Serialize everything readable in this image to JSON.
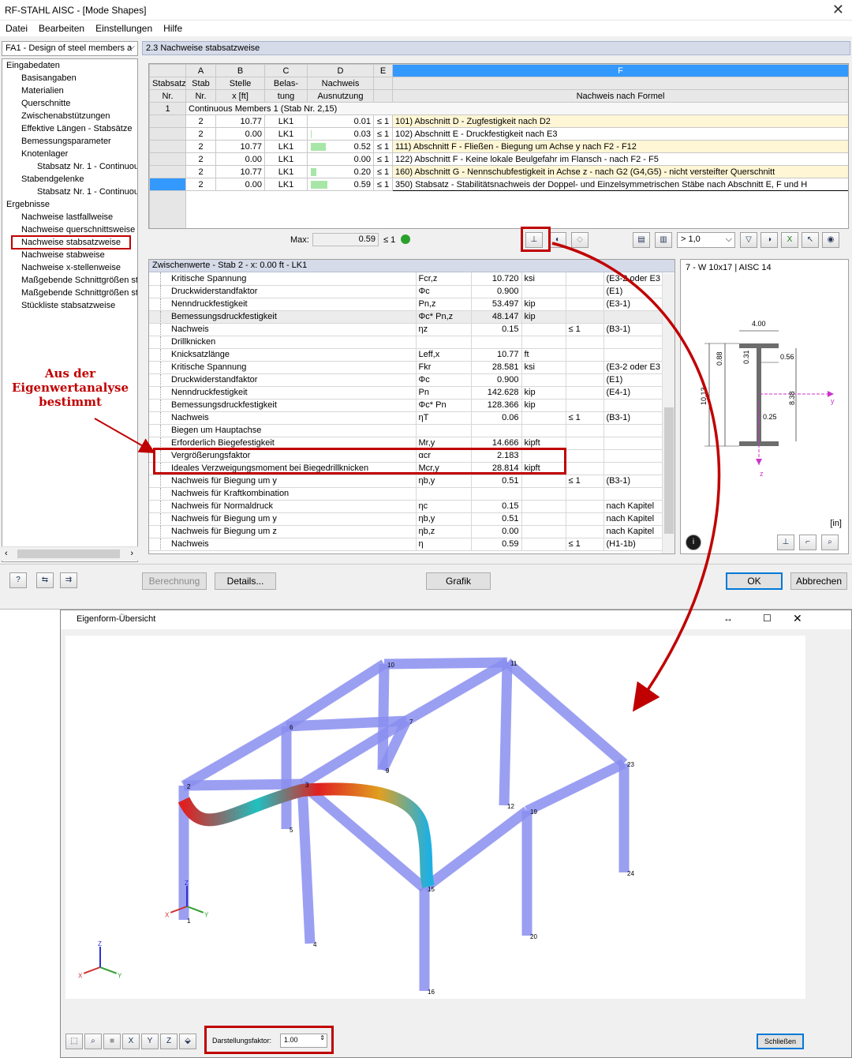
{
  "window": {
    "title": "RF-STAHL AISC - [Mode Shapes]",
    "close": "✕"
  },
  "menu": [
    "Datei",
    "Bearbeiten",
    "Einstellungen",
    "Hilfe"
  ],
  "case_combo": "FA1 - Design of steel members a",
  "tree": [
    {
      "label": "Eingabedaten",
      "level": 0
    },
    {
      "label": "Basisangaben",
      "level": 1
    },
    {
      "label": "Materialien",
      "level": 1
    },
    {
      "label": "Querschnitte",
      "level": 1
    },
    {
      "label": "Zwischenabstützungen",
      "level": 1
    },
    {
      "label": "Effektive Längen - Stabsätze",
      "level": 1
    },
    {
      "label": "Bemessungsparameter",
      "level": 1
    },
    {
      "label": "Knotenlager",
      "level": 1
    },
    {
      "label": "Stabsatz Nr. 1 - Continuous",
      "level": 2
    },
    {
      "label": "Stabendgelenke",
      "level": 1
    },
    {
      "label": "Stabsatz Nr. 1 - Continuous",
      "level": 2
    },
    {
      "label": "Ergebnisse",
      "level": 0
    },
    {
      "label": "Nachweise lastfallweise",
      "level": 1
    },
    {
      "label": "Nachweise querschnittsweise",
      "level": 1
    },
    {
      "label": "Nachweise stabsatzweise",
      "level": 1,
      "selected": true
    },
    {
      "label": "Nachweise stabweise",
      "level": 1
    },
    {
      "label": "Nachweise x-stellenweise",
      "level": 1
    },
    {
      "label": "Maßgebende Schnittgrößen sta",
      "level": 1
    },
    {
      "label": "Maßgebende Schnittgrößen sta",
      "level": 1
    },
    {
      "label": "Stückliste stabsatzweise",
      "level": 1
    }
  ],
  "section_title": "2.3 Nachweise stabsatzweise",
  "grid": {
    "col_letters": [
      "A",
      "B",
      "C",
      "D",
      "E",
      "F"
    ],
    "head1": {
      "stabsatz": "Stabsatz",
      "stab": "Stab",
      "stelle": "Stelle",
      "belas": "Belas-",
      "nachweis": "Nachweis"
    },
    "head2": {
      "nr": "Nr.",
      "stabnr": "Nr.",
      "x": "x [ft]",
      "tung": "tung",
      "ausnutzung": "Ausnutzung",
      "formel": "Nachweis nach Formel"
    },
    "group": {
      "nr": "1",
      "label": "Continuous Members 1 (Stab Nr. 2,15)"
    },
    "rows": [
      {
        "stab": "2",
        "x": "10.77",
        "lc": "LK1",
        "val": "0.01",
        "le": "≤ 1",
        "formula": "101) Abschnitt D - Zugfestigkeit nach D2",
        "bar": 0.01
      },
      {
        "stab": "2",
        "x": "0.00",
        "lc": "LK1",
        "val": "0.03",
        "le": "≤ 1",
        "formula": "102) Abschnitt E - Druckfestigkeit nach E3",
        "bar": 0.03
      },
      {
        "stab": "2",
        "x": "10.77",
        "lc": "LK1",
        "val": "0.52",
        "le": "≤ 1",
        "formula": "111) Abschnitt F - Fließen - Biegung um Achse y nach F2 - F12",
        "bar": 0.52
      },
      {
        "stab": "2",
        "x": "0.00",
        "lc": "LK1",
        "val": "0.00",
        "le": "≤ 1",
        "formula": "122) Abschnitt F - Keine lokale Beulgefahr im Flansch - nach F2 - F5",
        "bar": 0.0
      },
      {
        "stab": "2",
        "x": "10.77",
        "lc": "LK1",
        "val": "0.20",
        "le": "≤ 1",
        "formula": "160) Abschnitt G - Nennschubfestigkeit in Achse z - nach G2 (G4,G5) - nicht versteifter Querschnitt",
        "bar": 0.2
      },
      {
        "stab": "2",
        "x": "0.00",
        "lc": "LK1",
        "val": "0.59",
        "le": "≤ 1",
        "formula": "350) Stabsatz - Stabilitätsnachweis der Doppel- und Einzelsymmetrischen Stäbe nach Abschnitt E, F und H",
        "bar": 0.59
      }
    ],
    "max_label": "Max:",
    "max_value": "0.59",
    "max_le": "≤ 1",
    "filter_value": "> 1,0"
  },
  "zw": {
    "title": "Zwischenwerte - Stab 2 - x: 0.00 ft - LK1",
    "rows": [
      {
        "i": 1,
        "name": "Kritische Spannung",
        "sym": "Fcr,z",
        "val": "10.720",
        "unit": "ksi",
        "le": "",
        "ref": "(E3-2 oder E3"
      },
      {
        "i": 1,
        "name": "Druckwiderstandfaktor",
        "sym": "Φc",
        "val": "0.900",
        "unit": "",
        "le": "",
        "ref": "(E1)"
      },
      {
        "i": 1,
        "name": "Nenndruckfestigkeit",
        "sym": "Pn,z",
        "val": "53.497",
        "unit": "kip",
        "le": "",
        "ref": "(E3-1)"
      },
      {
        "i": 1,
        "name": "Bemessungsdruckfestigkeit",
        "sym": "Φc* Pn,z",
        "val": "48.147",
        "unit": "kip",
        "le": "",
        "ref": "",
        "grey": true
      },
      {
        "i": 1,
        "name": "Nachweis",
        "sym": "ηz",
        "val": "0.15",
        "unit": "",
        "le": "≤ 1",
        "ref": "(B3-1)"
      },
      {
        "i": 0,
        "name": "Drillknicken",
        "sym": "",
        "val": "",
        "unit": "",
        "le": "",
        "ref": ""
      },
      {
        "i": 1,
        "name": "Knicksatzlänge",
        "sym": "Leff,x",
        "val": "10.77",
        "unit": "ft",
        "le": "",
        "ref": ""
      },
      {
        "i": 1,
        "name": "Kritische Spannung",
        "sym": "Fkr",
        "val": "28.581",
        "unit": "ksi",
        "le": "",
        "ref": "(E3-2 oder E3"
      },
      {
        "i": 1,
        "name": "Druckwiderstandfaktor",
        "sym": "Φc",
        "val": "0.900",
        "unit": "",
        "le": "",
        "ref": "(E1)"
      },
      {
        "i": 1,
        "name": "Nenndruckfestigkeit",
        "sym": "Pn",
        "val": "142.628",
        "unit": "kip",
        "le": "",
        "ref": "(E4-1)"
      },
      {
        "i": 1,
        "name": "Bemessungsdruckfestigkeit",
        "sym": "Φc* Pn",
        "val": "128.366",
        "unit": "kip",
        "le": "",
        "ref": ""
      },
      {
        "i": 1,
        "name": "Nachweis",
        "sym": "ηT",
        "val": "0.06",
        "unit": "",
        "le": "≤ 1",
        "ref": "(B3-1)"
      },
      {
        "i": 0,
        "name": "Biegen um Hauptachse",
        "sym": "",
        "val": "",
        "unit": "",
        "le": "",
        "ref": ""
      },
      {
        "i": 1,
        "name": "Erforderlich Biegefestigkeit",
        "sym": "Mr,y",
        "val": "14.666",
        "unit": "kipft",
        "le": "",
        "ref": ""
      },
      {
        "i": 1,
        "name": "Vergrößerungsfaktor",
        "sym": "αcr",
        "val": "2.183",
        "unit": "",
        "le": "",
        "ref": ""
      },
      {
        "i": 1,
        "name": "Ideales Verzweigungsmoment bei Biegedrillknicken",
        "sym": "Mcr,y",
        "val": "28.814",
        "unit": "kipft",
        "le": "",
        "ref": ""
      },
      {
        "i": 0,
        "name": "Nachweis für Biegung um y",
        "sym": "ηb,y",
        "val": "0.51",
        "unit": "",
        "le": "≤ 1",
        "ref": "(B3-1)"
      },
      {
        "i": 0,
        "name": "Nachweis für Kraftkombination",
        "sym": "",
        "val": "",
        "unit": "",
        "le": "",
        "ref": ""
      },
      {
        "i": 1,
        "name": "Nachweis für Normaldruck",
        "sym": "ηc",
        "val": "0.15",
        "unit": "",
        "le": "",
        "ref": "nach Kapitel"
      },
      {
        "i": 1,
        "name": "Nachweis für Biegung um y",
        "sym": "ηb,y",
        "val": "0.51",
        "unit": "",
        "le": "",
        "ref": "nach Kapitel"
      },
      {
        "i": 1,
        "name": "Nachweis für Biegung um z",
        "sym": "ηb,z",
        "val": "0.00",
        "unit": "",
        "le": "",
        "ref": "nach Kapitel"
      },
      {
        "i": 1,
        "name": "Nachweis",
        "sym": "η",
        "val": "0.59",
        "unit": "",
        "le": "≤ 1",
        "ref": "(H1-1b)"
      }
    ]
  },
  "section": {
    "title": "7 - W 10x17 | AISC 14",
    "dim_width": "4.00",
    "dim_flange": "0.31",
    "dim_08": "0.88",
    "dim_web": "0.56",
    "dim_height": "10.13",
    "dim_838": "8.38",
    "dim_025": "0.25",
    "axis_y": "y",
    "axis_z": "z",
    "unit": "[in]"
  },
  "annotation": [
    "Aus der",
    "Eigenwertanalyse",
    "bestimmt"
  ],
  "buttons": {
    "berechnung": "Berechnung",
    "details": "Details...",
    "grafik": "Grafik",
    "ok": "OK",
    "abbrechen": "Abbrechen"
  },
  "eigen": {
    "title": "Eigenform-Übersicht",
    "factor_label": "Darstellungsfaktor:",
    "factor_value": "1.00",
    "close": "Schließen",
    "nodes": [
      "1",
      "2",
      "3",
      "4",
      "5",
      "6",
      "7",
      "9",
      "10",
      "11",
      "12",
      "15",
      "16",
      "19",
      "20",
      "23",
      "24"
    ],
    "axes": {
      "x": "X",
      "y": "Y",
      "z": "Z"
    }
  },
  "colors": {
    "accent_red": "#c00000",
    "header_blue": "#d6dbe9",
    "selected_blue": "#3399ff",
    "beam_blue": "#8a8ef0",
    "green_ok": "#2aa02a"
  }
}
